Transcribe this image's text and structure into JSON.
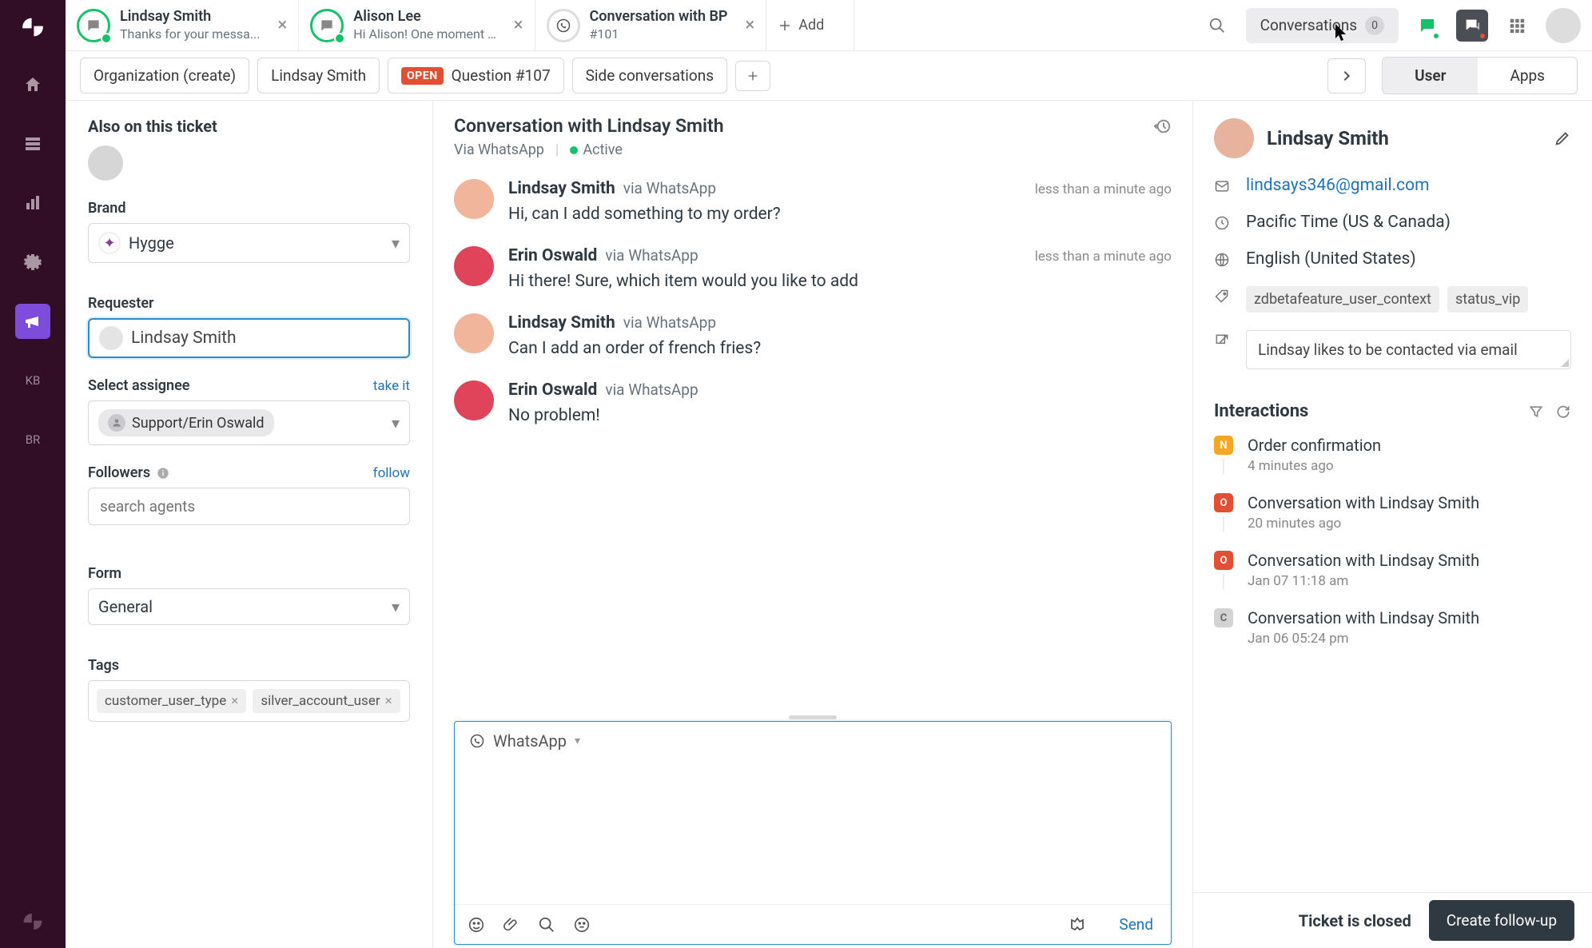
{
  "tabs": [
    {
      "title": "Lindsay Smith",
      "sub": "Thanks for your messa...",
      "type": "chat"
    },
    {
      "title": "Alison Lee",
      "sub": "Hi Alison! One moment …",
      "type": "chat"
    },
    {
      "title": "Conversation with BP",
      "sub": "#101",
      "type": "wa"
    }
  ],
  "add_label": "Add",
  "topbar": {
    "conversations_label": "Conversations",
    "conversations_count": "0"
  },
  "breadcrumb": {
    "org": "Organization (create)",
    "user": "Lindsay Smith",
    "open_badge": "OPEN",
    "ticket": "Question #107",
    "side": "Side conversations"
  },
  "toggle": {
    "user": "User",
    "apps": "Apps"
  },
  "left": {
    "also": "Also on this ticket",
    "brand_label": "Brand",
    "brand_value": "Hygge",
    "requester_label": "Requester",
    "requester_value": "Lindsay Smith",
    "assignee_label": "Select assignee",
    "take_it": "take it",
    "assignee_value": "Support/Erin Oswald",
    "followers_label": "Followers",
    "follow": "follow",
    "followers_placeholder": "search agents",
    "form_label": "Form",
    "form_value": "General",
    "tags_label": "Tags",
    "tags": [
      "customer_user_type",
      "silver_account_user"
    ]
  },
  "conversation": {
    "title": "Conversation with Lindsay Smith",
    "via": "Via WhatsApp",
    "active": "Active",
    "messages": [
      {
        "who": "cust",
        "name": "Lindsay Smith",
        "via": "via WhatsApp",
        "time": "less than a minute ago",
        "text": "Hi, can I add something to my order?"
      },
      {
        "who": "agent",
        "name": "Erin Oswald",
        "via": "via WhatsApp",
        "time": "less than a minute ago",
        "text": "Hi there! Sure, which item would you like to add"
      },
      {
        "who": "cust",
        "name": "Lindsay Smith",
        "via": "via WhatsApp",
        "time": "",
        "text": "Can I add an order of french fries?"
      },
      {
        "who": "agent",
        "name": "Erin Oswald",
        "via": "via WhatsApp",
        "time": "",
        "text": "No problem!"
      }
    ],
    "composer_channel": "WhatsApp",
    "send": "Send"
  },
  "profile": {
    "name": "Lindsay Smith",
    "email": "lindsays346@gmail.com",
    "timezone": "Pacific Time (US & Canada)",
    "language": "English (United States)",
    "tags": [
      "zdbetafeature_user_context",
      "status_vip"
    ],
    "note": "Lindsay likes to be contacted via email"
  },
  "interactions": {
    "title": "Interactions",
    "items": [
      {
        "badge": "N",
        "cls": "bN",
        "title": "Order confirmation",
        "time": "4 minutes ago"
      },
      {
        "badge": "O",
        "cls": "bO",
        "title": "Conversation with Lindsay Smith",
        "time": "20 minutes ago"
      },
      {
        "badge": "O",
        "cls": "bO",
        "title": "Conversation with Lindsay Smith",
        "time": "Jan 07 11:18 am"
      },
      {
        "badge": "C",
        "cls": "bC",
        "title": "Conversation with Lindsay Smith",
        "time": "Jan 06 05:24 pm"
      }
    ]
  },
  "footer": {
    "closed": "Ticket is closed",
    "follow": "Create follow-up"
  },
  "rail": {
    "kb": "KB",
    "br": "BR"
  }
}
